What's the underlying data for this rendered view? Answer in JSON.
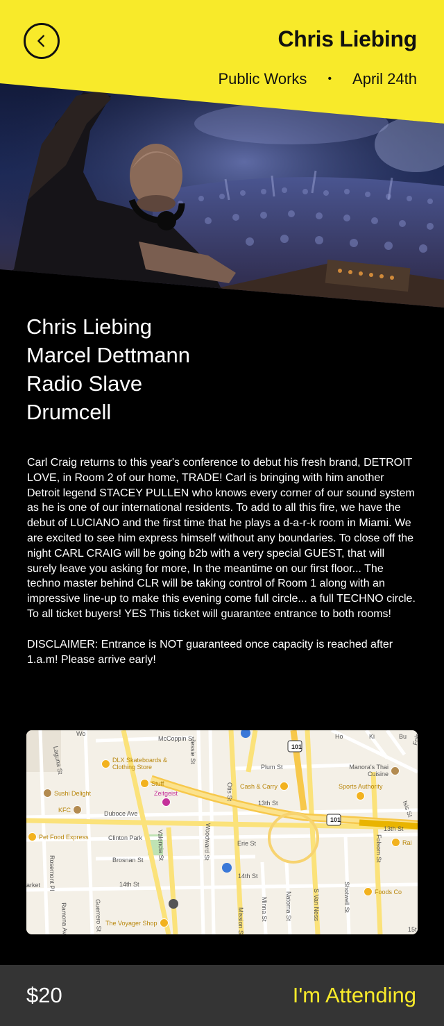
{
  "header": {
    "title": "Chris Liebing",
    "venue": "Public Works",
    "separator": "•",
    "date": "April 24th",
    "back_icon": "chevron-left-icon",
    "accent_color": "#f8ea2a"
  },
  "lineup": [
    "Chris Liebing",
    "Marcel Dettmann",
    "Radio Slave",
    "Drumcell"
  ],
  "description": {
    "body": "Carl Craig returns to this year's conference to debut his fresh brand, DETROIT LOVE, in Room 2 of our home, TRADE!  Carl is bringing with him another Detroit legend STACEY PULLEN who knows every corner of our sound system as he is one of our international residents. To add to all this fire, we have the debut of LUCIANO and the first time that he plays a d-a-r-k room in Miami. We are excited to see him express himself without any boundaries. To close off the night CARL CRAIG will be going b2b with a very special GUEST, that will surely leave you asking for more, In the meantime on our first floor... The techno master behind CLR will be taking control of Room 1 along with an impressive line-up to make this evening come full circle... a full TECHNO circle. To all ticket buyers! YES This ticket will guarantee entrance to both rooms!",
    "disclaimer": "DISCLAIMER: Entrance is NOT guaranteed once capacity is reached after 1.a.m! Please arrive early!"
  },
  "map": {
    "streets": {
      "laguna": "Laguna St",
      "mccoppin": "McCoppin St",
      "jessie": "Jessie St",
      "plum": "Plum St",
      "otis": "Otis St",
      "thirteenth": "13th St",
      "thirteenth_e": "13th St",
      "duboce": "Duboce Ave",
      "clinton": "Clinton Park",
      "valencia": "Valencia St",
      "woodward": "Woodward St",
      "erie": "Erie St",
      "brosnan": "Brosnan St",
      "fourteenth": "14th St",
      "fourteenth_e": "14th St",
      "rosemont": "Rosemont Pl",
      "ramona": "Ramona Av",
      "guerrero": "Guerrero St",
      "mission": "Mission St",
      "minna": "Minna St",
      "natoma": "Natoma St",
      "svanness": "S Van Ness",
      "shotwell": "Shotwell St",
      "folsom": "Folsom St",
      "folsom_top": "Folsom",
      "isis": "Isis St",
      "fifteenth": "15t",
      "market": "arket",
      "ho": "Ho",
      "ki": "Ki",
      "bu": "Bu",
      "wo": "Wo"
    },
    "highway_101": "101",
    "pois": {
      "dlx": "DLX Skateboards & Clothing Store",
      "stuff": "Stuff",
      "zeitgeist": "Zeitgeist",
      "sushi": "Sushi Delight",
      "kfc": "KFC",
      "petfood": "Pet Food Express",
      "cashcarry": "Cash & Carry",
      "manora": "Manora's Thai Cuisine",
      "sports": "Sports Authority",
      "rai": "Rai",
      "foods": "Foods Co",
      "voyager": "The Voyager Shop"
    }
  },
  "footer": {
    "price": "$20",
    "cta": "I'm Attending"
  }
}
